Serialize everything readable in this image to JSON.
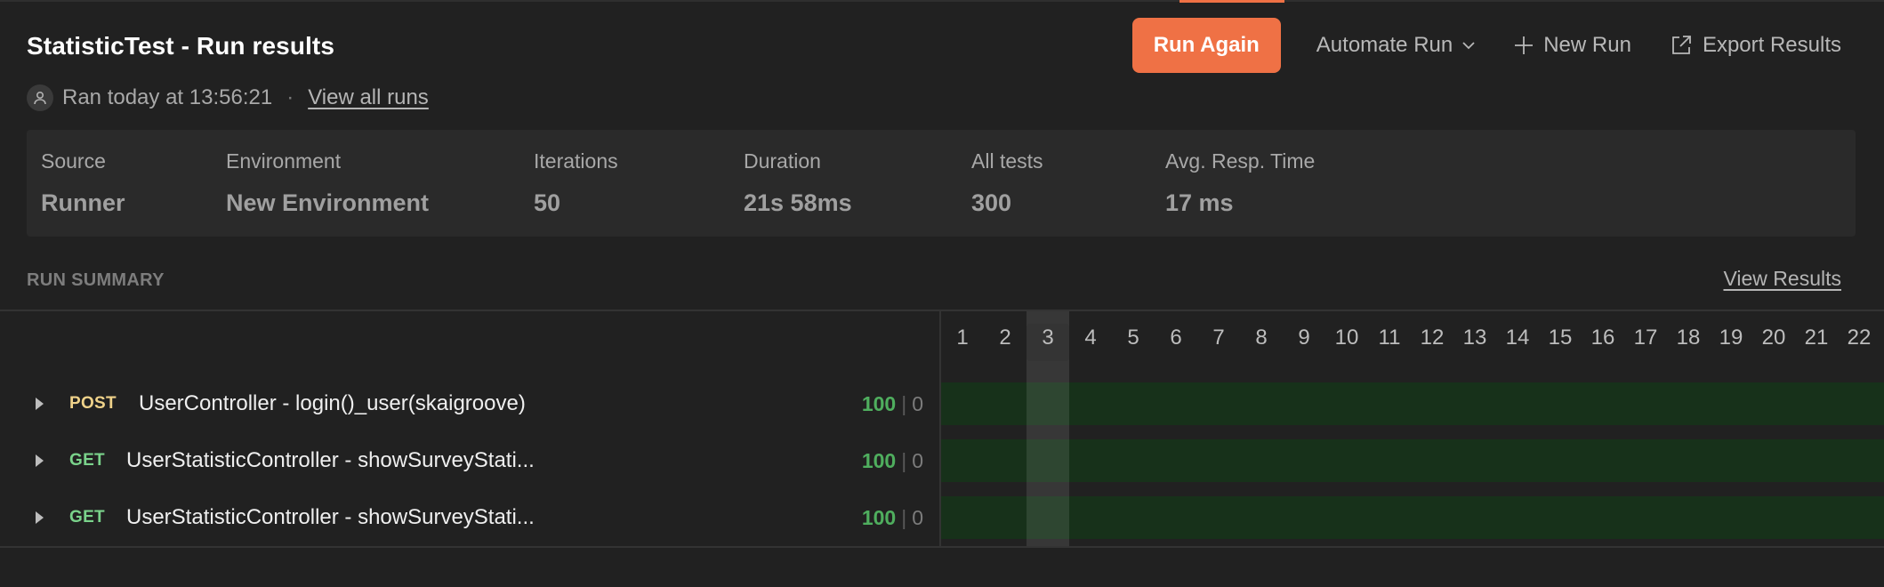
{
  "header": {
    "title": "StatisticTest - Run results",
    "ran_text": "Ran today at 13:56:21",
    "separator": "·",
    "view_all_runs": "View all runs"
  },
  "actions": {
    "run_again": "Run Again",
    "automate_run": "Automate Run",
    "new_run": "New Run",
    "export_results": "Export Results"
  },
  "stats": [
    {
      "label": "Source",
      "value": "Runner"
    },
    {
      "label": "Environment",
      "value": "New Environment"
    },
    {
      "label": "Iterations",
      "value": "50"
    },
    {
      "label": "Duration",
      "value": "21s 58ms"
    },
    {
      "label": "All tests",
      "value": "300"
    },
    {
      "label": "Avg. Resp. Time",
      "value": "17 ms"
    }
  ],
  "summary": {
    "label": "RUN SUMMARY",
    "view_results": "View Results"
  },
  "iterations": {
    "numbers": [
      "1",
      "2",
      "3",
      "4",
      "5",
      "6",
      "7",
      "8",
      "9",
      "10",
      "11",
      "12",
      "13",
      "14",
      "15",
      "16",
      "17",
      "18",
      "19",
      "20",
      "21",
      "22"
    ],
    "selected": "3"
  },
  "requests": [
    {
      "method": "POST",
      "name": "UserController - login()_user(skaigroove)",
      "passed": "100",
      "failed": "0"
    },
    {
      "method": "GET",
      "name": "UserStatisticController - showSurveyStati...",
      "passed": "100",
      "failed": "0"
    },
    {
      "method": "GET",
      "name": "UserStatisticController - showSurveyStati...",
      "passed": "100",
      "failed": "0"
    }
  ],
  "colors": {
    "accent": "#ef7145",
    "pass_bar": "#17311a",
    "pass_text": "#4fae5e",
    "post_method": "#efd28a",
    "get_method": "#7ad38b"
  },
  "icons": {
    "user": "user-icon",
    "chevron": "chevron-down-icon",
    "plus": "plus-icon",
    "export": "export-icon",
    "expand": "caret-right-icon"
  }
}
